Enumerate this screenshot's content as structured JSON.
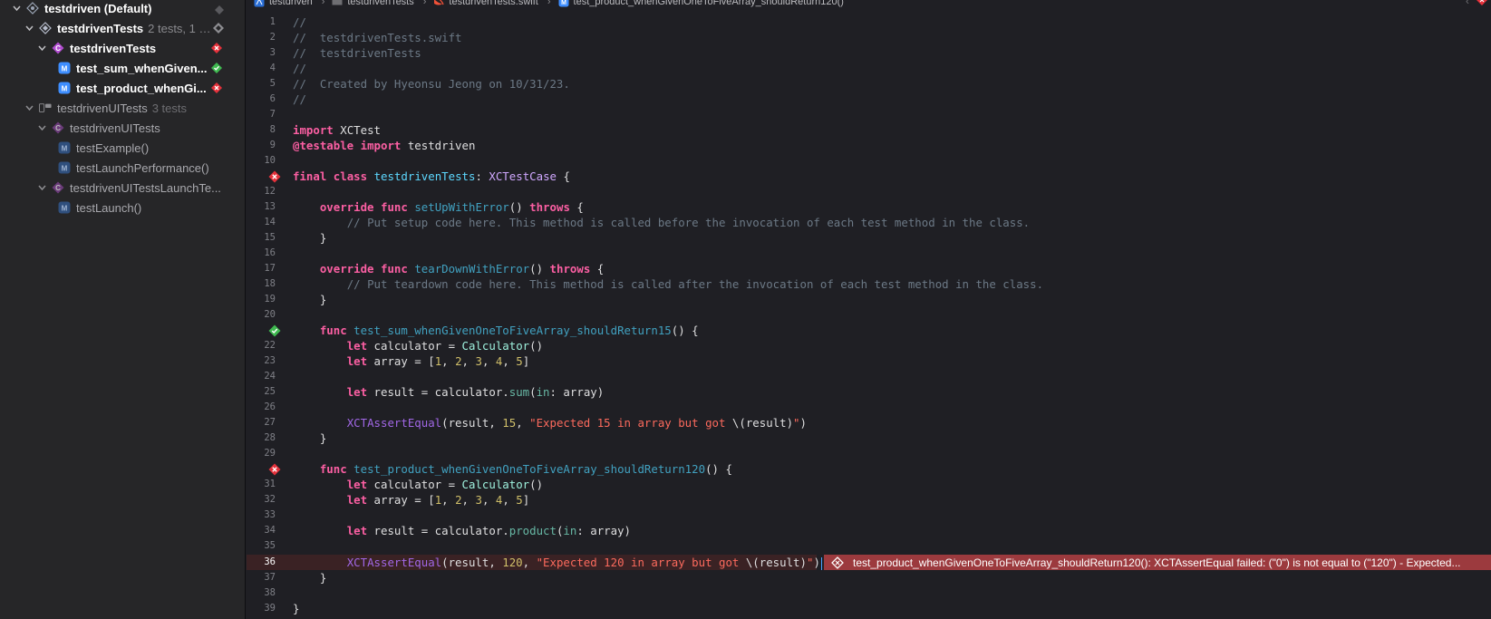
{
  "sidebar": {
    "nodes": [
      {
        "label": "testdriven (Default)",
        "sub": "",
        "status": ""
      },
      {
        "label": "testdrivenTests",
        "sub": "2 tests, 1 f...",
        "status": ""
      },
      {
        "label": "testdrivenTests",
        "sub": "",
        "status": "failed"
      },
      {
        "label": "test_sum_whenGiven...",
        "sub": "",
        "status": "passed"
      },
      {
        "label": "test_product_whenGi...",
        "sub": "",
        "status": "failed"
      },
      {
        "label": "testdrivenUITests",
        "sub": "3 tests",
        "status": ""
      },
      {
        "label": "testdrivenUITests",
        "sub": "",
        "status": ""
      },
      {
        "label": "testExample()",
        "sub": "",
        "status": ""
      },
      {
        "label": "testLaunchPerformance()",
        "sub": "",
        "status": ""
      },
      {
        "label": "testdrivenUITestsLaunchTe...",
        "sub": "",
        "status": ""
      },
      {
        "label": "testLaunch()",
        "sub": "",
        "status": ""
      }
    ]
  },
  "jumpbar": {
    "crumbs": [
      "testdriven",
      "testdrivenTests",
      "testdrivenTests.swift",
      "test_product_whenGivenOneToFiveArray_shouldReturn120()"
    ]
  },
  "editor": {
    "current_line": "36",
    "line_numbers": [
      "1",
      "2",
      "3",
      "4",
      "5",
      "6",
      "7",
      "8",
      "9",
      "10",
      "11",
      "12",
      "13",
      "14",
      "15",
      "16",
      "17",
      "18",
      "19",
      "20",
      "21",
      "22",
      "23",
      "24",
      "25",
      "26",
      "27",
      "28",
      "29",
      "30",
      "31",
      "32",
      "33",
      "34",
      "35",
      "36",
      "37",
      "38",
      "39"
    ],
    "tokens": {
      "l1": "//",
      "l2": "//  testdrivenTests.swift",
      "l3": "//  testdrivenTests",
      "l4": "//",
      "l5": "//  Created by Hyeonsu Jeong on 10/31/23.",
      "l6": "//",
      "import": "import",
      "xctest": "XCTest",
      "testable": "@testable",
      "testdriven": "testdriven",
      "final": "final",
      "class": "class",
      "classname": "testdrivenTests",
      "colon": ": ",
      "xctestcase": "XCTestCase",
      "open_brace": " {",
      "close_brace": "}",
      "indent1": "    ",
      "indent2": "        ",
      "override": "override",
      "func": "func",
      "setup": "setUpWithError",
      "teardown": "tearDownWithError",
      "throws": "throws",
      "parens": "()",
      "space": " ",
      "setup_cmt": "// Put setup code here. This method is called before the invocation of each test method in the class.",
      "teardown_cmt": "// Put teardown code here. This method is called after the invocation of each test method in the class.",
      "test_sum": "test_sum_whenGivenOneToFiveArray_shouldReturn15",
      "test_product": "test_product_whenGivenOneToFiveArray_shouldReturn120",
      "let": "let",
      "calc_assign": " calculator = ",
      "Calculator": "Calculator",
      "array_assign": " array = [",
      "n1": "1",
      "n2": "2",
      "n3": "3",
      "n4": "4",
      "n5": "5",
      "comma": ", ",
      "close_bracket": "]",
      "result_assign": " result = calculator.",
      "sum": "sum",
      "product": "product",
      "in": "in",
      "arg_array": ": array)",
      "open_paren": "(",
      "assert": "XCTAssertEqual",
      "result_comma": "(result, ",
      "n15": "15",
      "n120": "120",
      "str15": "\"Expected 15 in array but got ",
      "str120": "\"Expected 120 in array but got ",
      "interp": "\\(result)",
      "quote_paren": "\")",
      "quote": "\"",
      "close_paren": ")"
    },
    "error_banner": "test_product_whenGivenOneToFiveArray_shouldReturn120(): XCTAssertEqual failed: (\"0\") is not equal to (\"120\") - Expected..."
  },
  "colors": {
    "failed": "#e5303a",
    "passed": "#3fb950",
    "method_icon": "#3e8eff",
    "class_icon": "#b14cd0"
  }
}
